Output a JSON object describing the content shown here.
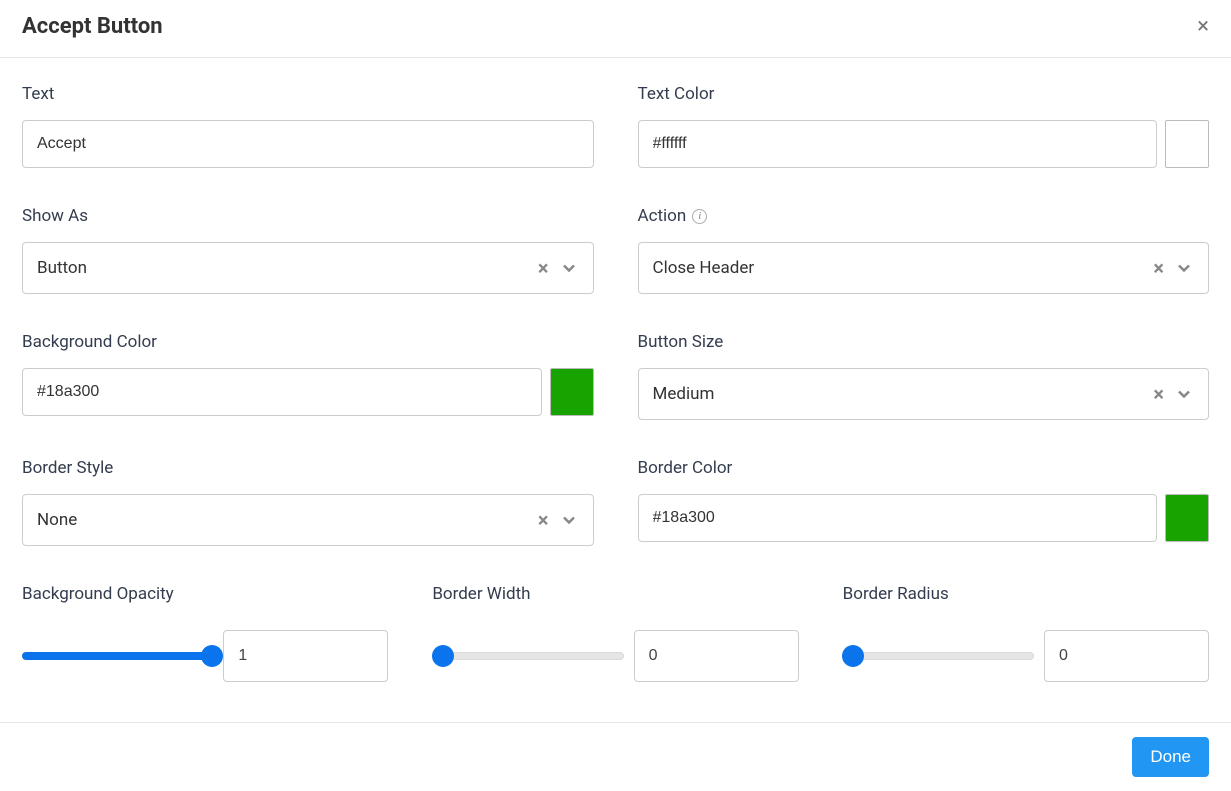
{
  "header": {
    "title": "Accept Button",
    "close_icon": "×"
  },
  "fields": {
    "text": {
      "label": "Text",
      "value": "Accept"
    },
    "text_color": {
      "label": "Text Color",
      "value": "#ffffff",
      "swatch": "#ffffff"
    },
    "show_as": {
      "label": "Show As",
      "value": "Button"
    },
    "action": {
      "label": "Action",
      "value": "Close Header"
    },
    "background_color": {
      "label": "Background Color",
      "value": "#18a300",
      "swatch": "#18a300"
    },
    "button_size": {
      "label": "Button Size",
      "value": "Medium"
    },
    "border_style": {
      "label": "Border Style",
      "value": "None"
    },
    "border_color": {
      "label": "Border Color",
      "value": "#18a300",
      "swatch": "#18a300"
    },
    "background_opacity": {
      "label": "Background Opacity",
      "value": "1",
      "percent": 100
    },
    "border_width": {
      "label": "Border Width",
      "value": "0",
      "percent": 0
    },
    "border_radius": {
      "label": "Border Radius",
      "value": "0",
      "percent": 0
    }
  },
  "footer": {
    "done_label": "Done"
  }
}
